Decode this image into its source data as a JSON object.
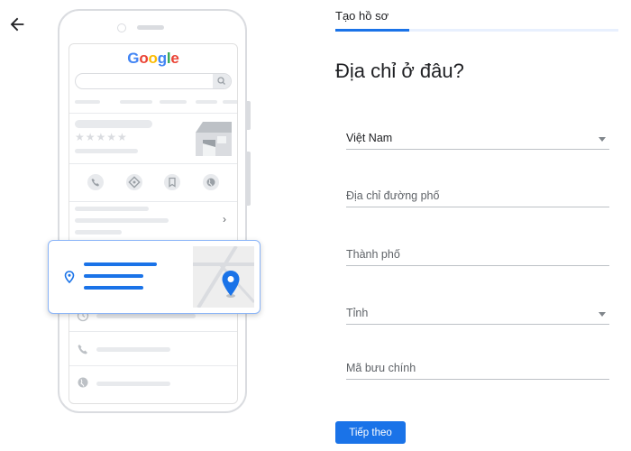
{
  "header": {
    "back_icon": "arrow-left-icon"
  },
  "illustration": {
    "logo_text": "Google",
    "logo_colors": [
      "#4285f4",
      "#ea4335",
      "#fbbc05",
      "#4285f4",
      "#34a853",
      "#ea4335"
    ],
    "star_count": 5,
    "action_icons": [
      "phone-icon",
      "directions-icon",
      "bookmark-icon",
      "globe-icon"
    ],
    "row_icons": [
      "clock-icon",
      "phone-icon",
      "globe-icon"
    ],
    "card_icon": "location-pin-icon",
    "map_pin_icon": "map-pin-icon"
  },
  "form": {
    "tab_label": "Tạo hồ sơ",
    "progress_fraction": 0.26,
    "heading": "Địa chỉ ở đâu?",
    "fields": [
      {
        "value": "Việt Nam",
        "dropdown": true
      },
      {
        "placeholder": "Địa chỉ đường phố"
      },
      {
        "placeholder": "Thành phố"
      },
      {
        "placeholder": "Tỉnh",
        "dropdown": true
      },
      {
        "placeholder": "Mã bưu chính"
      }
    ],
    "next_label": "Tiếp theo"
  },
  "colors": {
    "accent": "#1a73e8",
    "placeholder_gray": "#e8eaed"
  }
}
